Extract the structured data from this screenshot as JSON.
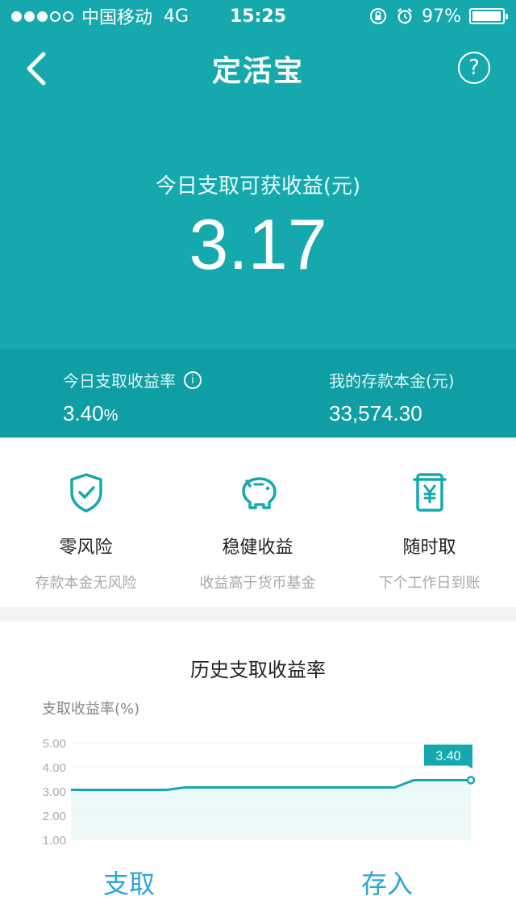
{
  "status": {
    "carrier": "中国移动",
    "network": "4G",
    "time": "15:25",
    "battery": "97%",
    "battery_fraction": 0.97
  },
  "nav": {
    "title": "定活宝",
    "back_icon": "chevron-left-icon",
    "help_icon": "question-circle-icon",
    "help_glyph": "?"
  },
  "hero": {
    "label": "今日支取可获收益(元)",
    "value": "3.17"
  },
  "stats": {
    "rate_label": "今日支取收益率",
    "rate_value": "3.40",
    "rate_unit": "%",
    "info_glyph": "i",
    "principal_label": "我的存款本金(元)",
    "principal_value": "33,574.30"
  },
  "features": [
    {
      "icon": "shield-check-icon",
      "title": "零风险",
      "subtitle": "存款本金无风险"
    },
    {
      "icon": "piggy-bank-icon",
      "title": "稳健收益",
      "subtitle": "收益高于货币基金"
    },
    {
      "icon": "yen-receipt-icon",
      "title": "随时取",
      "subtitle": "下个工作日到账"
    }
  ],
  "chart_data": {
    "type": "line",
    "title": "历史支取收益率",
    "ylabel": "支取收益率(%)",
    "ylim": [
      1.0,
      5.0
    ],
    "yticks": [
      "5.00",
      "4.00",
      "3.00",
      "2.00",
      "1.00"
    ],
    "values": [
      3.05,
      3.05,
      3.05,
      3.05,
      3.05,
      3.05,
      3.15,
      3.15,
      3.15,
      3.15,
      3.15,
      3.15,
      3.15,
      3.15,
      3.15,
      3.15,
      3.15,
      3.15,
      3.45,
      3.45,
      3.45,
      3.45
    ],
    "last_label": "3.40",
    "color": "#15a9ad"
  },
  "bottom": {
    "withdraw": "支取",
    "deposit": "存入"
  },
  "colors": {
    "primary": "#15a9ad",
    "stats_bg": "#0f9ea3",
    "link": "#2aa6d8"
  }
}
